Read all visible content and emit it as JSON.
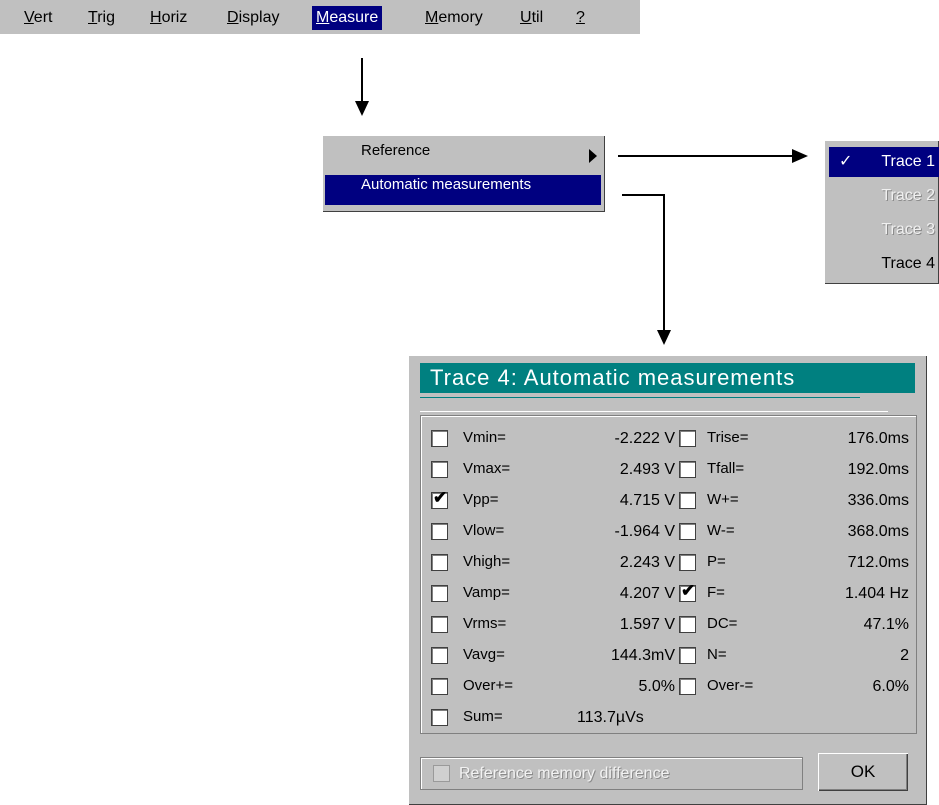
{
  "menubar": {
    "items": [
      {
        "first": "V",
        "rest": "ert"
      },
      {
        "first": "T",
        "rest": "rig"
      },
      {
        "first": "H",
        "rest": "oriz"
      },
      {
        "first": "D",
        "rest": "isplay"
      },
      {
        "first": "M",
        "rest": "easure"
      },
      {
        "first": "M",
        "rest": "emory"
      },
      {
        "first": "U",
        "rest": "til"
      },
      {
        "first": "?",
        "rest": ""
      }
    ],
    "active_color": "#000080"
  },
  "measure_menu": {
    "reference_label": "Reference",
    "automatic_label": "Automatic measurements"
  },
  "trace_menu": {
    "check": "✓",
    "items": [
      "Trace 1",
      "Trace 2",
      "Trace 3",
      "Trace 4"
    ],
    "selected": "Trace 1",
    "disabled": [
      "Trace 2",
      "Trace 3"
    ]
  },
  "dialog": {
    "title": "Trace 4: Automatic measurements",
    "title_color": "#008080",
    "left_column": [
      {
        "label": "Vmin=",
        "value": "-2.222 V",
        "checked": false
      },
      {
        "label": "Vmax=",
        "value": "2.493 V",
        "checked": false
      },
      {
        "label": "Vpp=",
        "value": "4.715 V",
        "checked": true
      },
      {
        "label": "Vlow=",
        "value": "-1.964 V",
        "checked": false
      },
      {
        "label": "Vhigh=",
        "value": "2.243 V",
        "checked": false
      },
      {
        "label": "Vamp=",
        "value": "4.207 V",
        "checked": false
      },
      {
        "label": "Vrms=",
        "value": "1.597 V",
        "checked": false
      },
      {
        "label": "Vavg=",
        "value": "144.3mV",
        "checked": false
      },
      {
        "label": "Over+=",
        "value": "5.0%",
        "checked": false
      },
      {
        "label": "Sum=",
        "value": "113.7µVs",
        "checked": false
      }
    ],
    "right_column": [
      {
        "label": "Trise=",
        "value": "176.0ms",
        "checked": false
      },
      {
        "label": "Tfall=",
        "value": "192.0ms",
        "checked": false
      },
      {
        "label": "W+=",
        "value": "336.0ms",
        "checked": false
      },
      {
        "label": "W-=",
        "value": "368.0ms",
        "checked": false
      },
      {
        "label": "P=",
        "value": "712.0ms",
        "checked": false
      },
      {
        "label": "F=",
        "value": "1.404 Hz",
        "checked": true
      },
      {
        "label": "DC=",
        "value": "47.1%",
        "checked": false
      },
      {
        "label": "N=",
        "value": "2",
        "checked": false
      },
      {
        "label": "Over-=",
        "value": "6.0%",
        "checked": false
      }
    ],
    "checkmark": "✔",
    "reference_diff_label": "Reference memory difference",
    "ok_label": "OK"
  }
}
